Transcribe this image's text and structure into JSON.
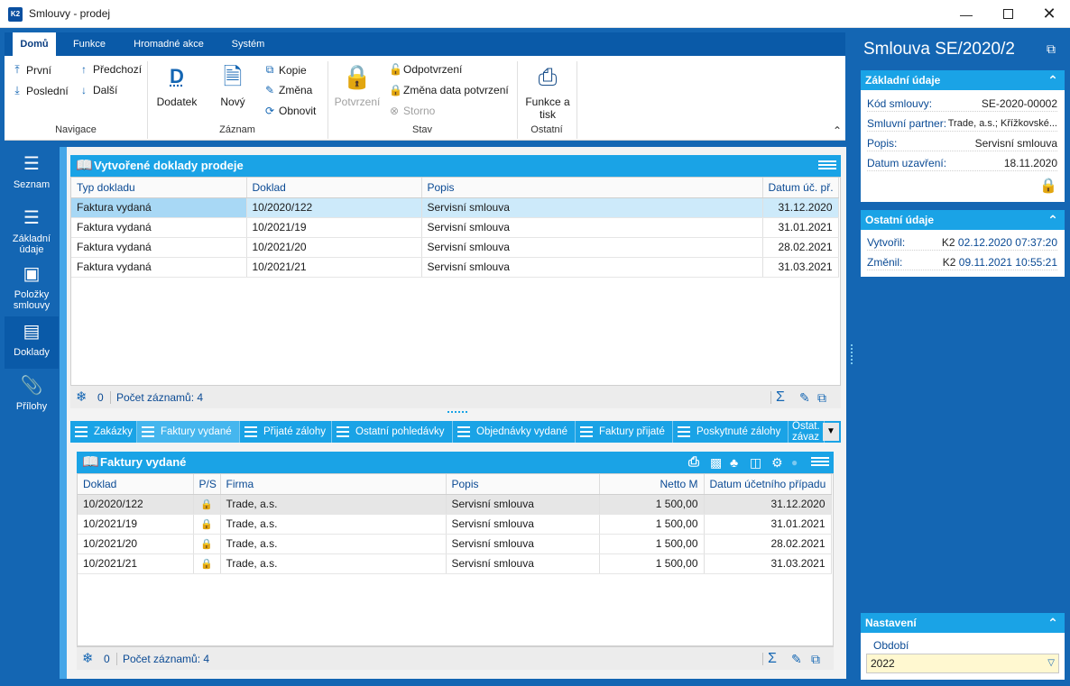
{
  "window": {
    "title": "Smlouvy - prodej",
    "icon_text": "K2"
  },
  "ribbon": {
    "tabs": [
      "Domů",
      "Funkce",
      "Hromadné akce",
      "Systém"
    ],
    "navigace": {
      "first": "První",
      "last": "Poslední",
      "prev": "Předchozí",
      "next": "Další",
      "label": "Navigace"
    },
    "zaznam": {
      "dodatek": "Dodatek",
      "novy": "Nový",
      "kopie": "Kopie",
      "zmena": "Změna",
      "obnovit": "Obnovit",
      "label": "Záznam"
    },
    "stav": {
      "potvrzeni": "Potvrzení",
      "odpotvrzeni": "Odpotvrzení",
      "zmena_data": "Změna data potvrzení",
      "storno": "Storno",
      "label": "Stav"
    },
    "ostatni": {
      "funkce": "Funkce a tisk",
      "label": "Ostatní"
    }
  },
  "sidenav": [
    {
      "label": "Seznam",
      "icon": "list-icon"
    },
    {
      "label": "Základní údaje",
      "icon": "details-icon"
    },
    {
      "label": "Položky smlouvy",
      "icon": "box-icon"
    },
    {
      "label": "Doklady",
      "icon": "documents-icon",
      "active": true
    },
    {
      "label": "Přílohy",
      "icon": "paperclip-icon"
    }
  ],
  "top_panel": {
    "title": "Vytvořené doklady prodeje",
    "columns": [
      "Typ dokladu",
      "Doklad",
      "Popis",
      "Datum úč. př."
    ],
    "rows": [
      [
        "Faktura vydaná",
        "10/2020/122",
        "Servisní smlouva",
        "31.12.2020"
      ],
      [
        "Faktura vydaná",
        "10/2021/19",
        "Servisní smlouva",
        "31.01.2021"
      ],
      [
        "Faktura vydaná",
        "10/2021/20",
        "Servisní smlouva",
        "28.02.2021"
      ],
      [
        "Faktura vydaná",
        "10/2021/21",
        "Servisní smlouva",
        "31.03.2021"
      ]
    ],
    "footer_count": "0",
    "footer_records": "Počet záznamů: 4"
  },
  "tabs": [
    "Zakázky",
    "Faktury vydané",
    "Přijaté zálohy",
    "Ostatní pohledávky",
    "Objednávky vydané",
    "Faktury přijaté",
    "Poskytnuté zálohy",
    "Ostat. závaz"
  ],
  "bottom_panel": {
    "title": "Faktury vydané",
    "columns": [
      "Doklad",
      "P/S",
      "Firma",
      "Popis",
      "Netto M",
      "Datum účetního případu"
    ],
    "rows": [
      [
        "10/2020/122",
        "Trade, a.s.",
        "Servisní smlouva",
        "1 500,00",
        "31.12.2020"
      ],
      [
        "10/2021/19",
        "Trade, a.s.",
        "Servisní smlouva",
        "1 500,00",
        "31.01.2021"
      ],
      [
        "10/2021/20",
        "Trade, a.s.",
        "Servisní smlouva",
        "1 500,00",
        "28.02.2021"
      ],
      [
        "10/2021/21",
        "Trade, a.s.",
        "Servisní smlouva",
        "1 500,00",
        "31.03.2021"
      ]
    ],
    "footer_count": "0",
    "footer_records": "Počet záznamů: 4"
  },
  "right_panel": {
    "title": "Smlouva SE/2020/2",
    "zakladni": {
      "header": "Základní údaje",
      "kod_label": "Kód smlouvy:",
      "kod_value": "SE-2020-00002",
      "partner_label": "Smluvní partner:",
      "partner_value": "Trade, a.s.; Křížkovské...",
      "popis_label": "Popis:",
      "popis_value": "Servisní smlouva",
      "datum_label": "Datum uzavření:",
      "datum_value": "18.11.2020"
    },
    "ostatni": {
      "header": "Ostatní údaje",
      "vytvoril_label": "Vytvořil:",
      "vytvoril_user": "K2",
      "vytvoril_date": "02.12.2020 07:37:20",
      "zmenil_label": "Změnil:",
      "zmenil_user": "K2",
      "zmenil_date": "09.11.2021 10:55:21"
    },
    "nastaveni": {
      "header": "Nastavení",
      "obdobi_label": "Období",
      "obdobi_value": "2022"
    }
  },
  "colors": {
    "frame": "#1466b3",
    "accent": "#1aa3e6",
    "lock": "#23b24c"
  }
}
